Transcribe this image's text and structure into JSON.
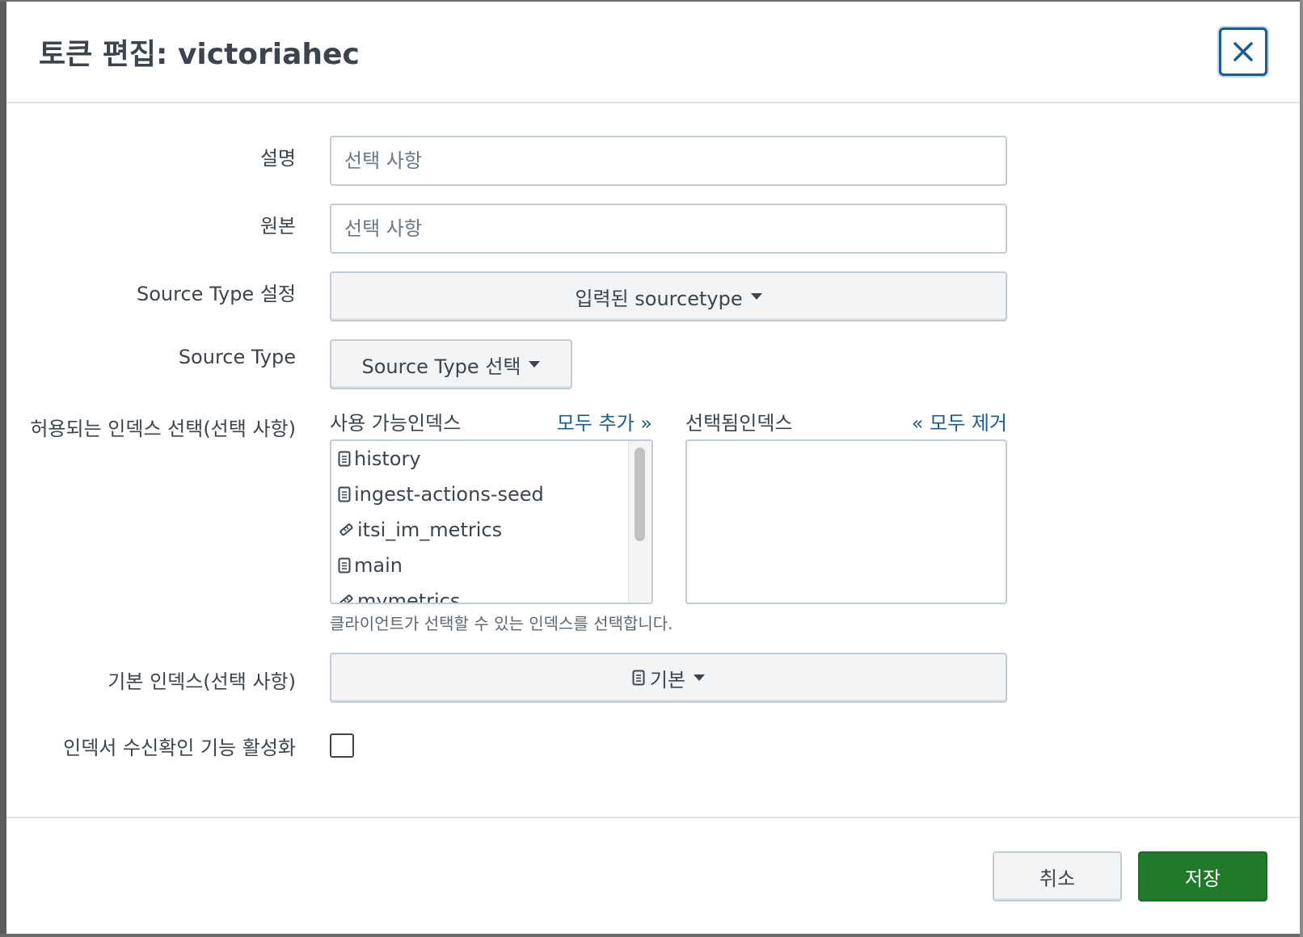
{
  "dialog": {
    "title": "토큰 편집: victoriahec",
    "close_icon": "close-icon"
  },
  "form": {
    "description": {
      "label": "설명",
      "placeholder": "선택 사항",
      "value": ""
    },
    "source": {
      "label": "원본",
      "placeholder": "선택 사항",
      "value": ""
    },
    "source_type_setting": {
      "label": "Source Type 설정",
      "selected": "입력된 sourcetype"
    },
    "source_type": {
      "label": "Source Type",
      "selected": "Source Type 선택"
    },
    "allowed_indexes": {
      "label": "허용되는 인덱스 선택(선택 사항)",
      "available_header": "사용 가능인덱스",
      "add_all": "모두 추가 »",
      "selected_header": "선택됨인덱스",
      "remove_all": "« 모두 제거",
      "available": [
        {
          "name": "history",
          "icon": "event-index-icon"
        },
        {
          "name": "ingest-actions-seed",
          "icon": "event-index-icon"
        },
        {
          "name": "itsi_im_metrics",
          "icon": "metrics-index-icon"
        },
        {
          "name": "main",
          "icon": "event-index-icon"
        },
        {
          "name": "mymetrics",
          "icon": "metrics-index-icon"
        }
      ],
      "selected": [],
      "help": "클라이언트가 선택할 수 있는 인덱스를 선택합니다."
    },
    "default_index": {
      "label": "기본 인덱스(선택 사항)",
      "selected": "기본",
      "icon": "event-index-icon"
    },
    "indexer_ack": {
      "label": "인덱서 수신확인 기능 활성화",
      "checked": false
    }
  },
  "footer": {
    "cancel_label": "취소",
    "save_label": "저장"
  },
  "colors": {
    "accent_link": "#1a5d8f",
    "primary_button": "#1f7a29"
  }
}
